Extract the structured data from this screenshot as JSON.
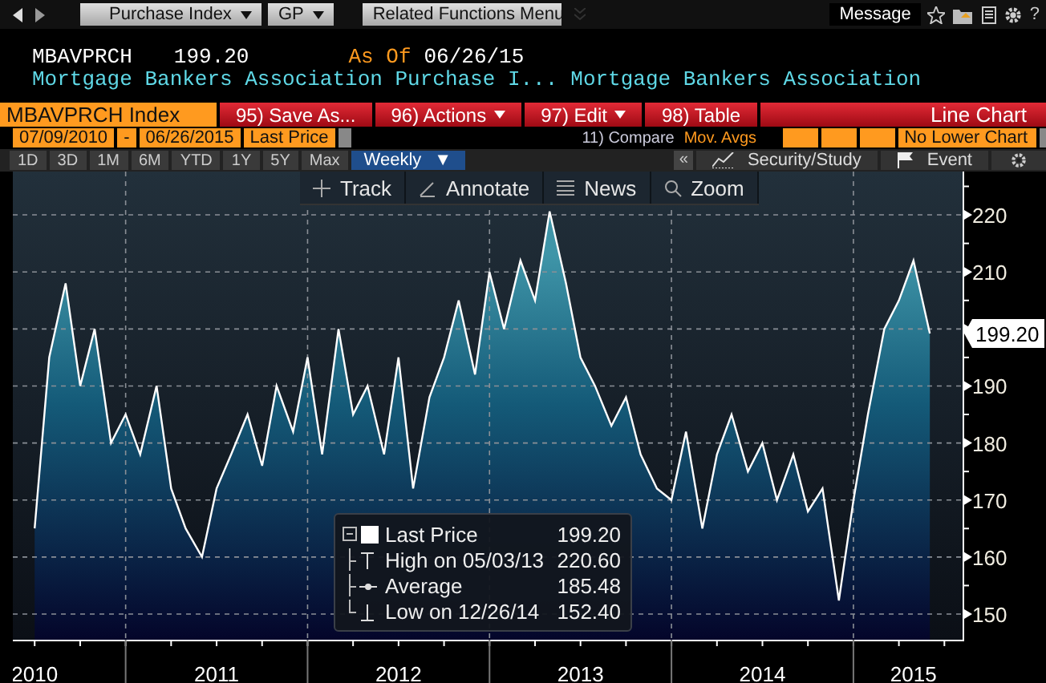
{
  "toolbar": {
    "menus": [
      {
        "label": "Purchase Index",
        "dropdown": true
      },
      {
        "label": "GP",
        "dropdown": true
      },
      {
        "label": "Related Functions Menu",
        "dropdown": false
      }
    ],
    "message": "Message",
    "help": "?"
  },
  "header": {
    "ticker": "MBAVPRCH",
    "value": "199.20",
    "as_of_label": "As Of",
    "as_of_date": "06/26/15",
    "description": "Mortgage Bankers Association Purchase I...",
    "source": "Mortgage Bankers Association"
  },
  "security": "MBAVPRCH Index",
  "actions": [
    {
      "label": "95) Save As...",
      "dropdown": false
    },
    {
      "label": "96) Actions",
      "dropdown": true
    },
    {
      "label": "97) Edit",
      "dropdown": true
    },
    {
      "label": "98) Table",
      "dropdown": false
    }
  ],
  "chart_type": "Line Chart",
  "range": {
    "start": "07/09/2010",
    "separator": "-",
    "end": "06/26/2015",
    "field": "Last Price"
  },
  "compare": "11) Compare",
  "mov_avgs": "Mov. Avgs",
  "lower_chart": "No Lower Chart",
  "periods": [
    {
      "label": "1D",
      "selected": false
    },
    {
      "label": "3D",
      "selected": false
    },
    {
      "label": "1M",
      "selected": false
    },
    {
      "label": "6M",
      "selected": false
    },
    {
      "label": "YTD",
      "selected": false
    },
    {
      "label": "1Y",
      "selected": false
    },
    {
      "label": "5Y",
      "selected": false
    },
    {
      "label": "Max",
      "selected": false
    }
  ],
  "frequency": {
    "label": "Weekly",
    "caret": "▼"
  },
  "collapse": "«",
  "study_buttons": [
    {
      "kind": "study",
      "label": "Security/Study"
    },
    {
      "kind": "event",
      "label": "Event"
    }
  ],
  "chart_tools": [
    {
      "kind": "track",
      "label": "Track"
    },
    {
      "kind": "annotate",
      "label": "Annotate"
    },
    {
      "kind": "news",
      "label": "News"
    },
    {
      "kind": "zoom",
      "label": "Zoom"
    }
  ],
  "legend": [
    {
      "kind": "last",
      "value": "199.20"
    },
    {
      "kind": "high",
      "label": "High on 05/03/13",
      "value": "220.60"
    },
    {
      "kind": "average",
      "label": "Average",
      "value": "185.48"
    },
    {
      "kind": "low",
      "label": "Low on 12/26/14",
      "value": "152.40"
    }
  ],
  "price_tag": "199.20",
  "chart_data": {
    "type": "area",
    "grid": true,
    "xlim": [
      2010.38,
      2015.6
    ],
    "ylim": [
      145.5,
      227.6
    ],
    "yticks": [
      150,
      160,
      170,
      180,
      190,
      210,
      220
    ],
    "xticks": [
      {
        "value": 2010.5,
        "label": "2010"
      },
      {
        "value": 2011.5,
        "label": "2011"
      },
      {
        "value": 2012.5,
        "label": "2012"
      },
      {
        "value": 2013.5,
        "label": "2013"
      },
      {
        "value": 2014.5,
        "label": "2014"
      },
      {
        "value": 2015.33,
        "label": "2015"
      }
    ],
    "x": [
      2010.5,
      2010.58,
      2010.67,
      2010.75,
      2010.83,
      2010.92,
      2011,
      2011.08,
      2011.17,
      2011.25,
      2011.33,
      2011.42,
      2011.5,
      2011.58,
      2011.67,
      2011.75,
      2011.83,
      2011.92,
      2012,
      2012.08,
      2012.17,
      2012.25,
      2012.33,
      2012.42,
      2012.5,
      2012.58,
      2012.67,
      2012.75,
      2012.83,
      2012.92,
      2013,
      2013.08,
      2013.17,
      2013.25,
      2013.33,
      2013.42,
      2013.5,
      2013.58,
      2013.67,
      2013.75,
      2013.83,
      2013.92,
      2014,
      2014.08,
      2014.17,
      2014.25,
      2014.33,
      2014.42,
      2014.5,
      2014.58,
      2014.67,
      2014.75,
      2014.83,
      2014.92,
      2015,
      2015.08,
      2015.17,
      2015.25,
      2015.33,
      2015.42
    ],
    "series": [
      {
        "name": "Last Price",
        "color": "#ffffff",
        "values": [
          165,
          195,
          208,
          190,
          200,
          180,
          185,
          178,
          190,
          172,
          165,
          160,
          172,
          178,
          185,
          176,
          190,
          182,
          195,
          178,
          200,
          185,
          190,
          178,
          195,
          172,
          188,
          195,
          205,
          192,
          210,
          200,
          212,
          205,
          220.6,
          208,
          195,
          190,
          183,
          188,
          178,
          172,
          170,
          182,
          165,
          178,
          185,
          175,
          180,
          170,
          178,
          168,
          172,
          152.4,
          170,
          185,
          200,
          205,
          212,
          199.2
        ]
      }
    ]
  }
}
